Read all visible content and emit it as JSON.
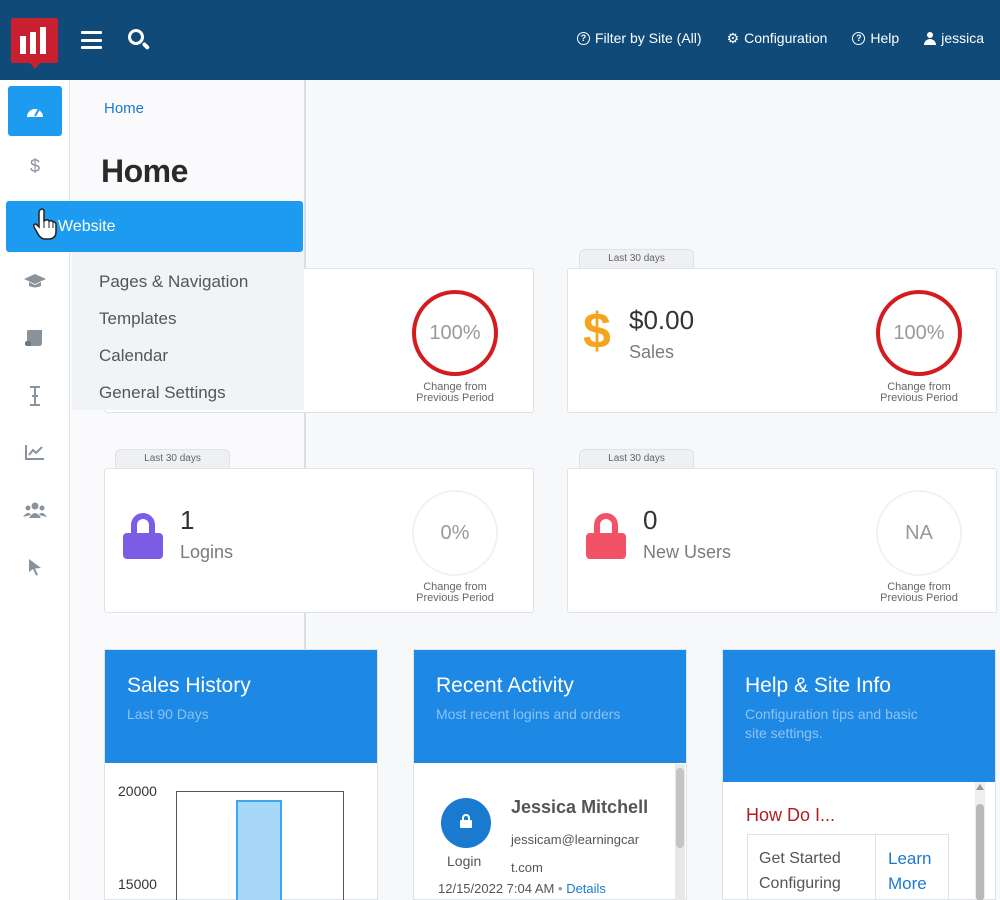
{
  "topbar": {
    "nav": [
      {
        "icon": "question-circle-icon",
        "label": "Filter by Site (All)"
      },
      {
        "icon": "gear-icon",
        "label": "Configuration"
      },
      {
        "icon": "question-circle-icon",
        "label": "Help"
      },
      {
        "icon": "user-icon",
        "label": "jessica"
      }
    ]
  },
  "rail": {
    "items": [
      "dashboard-icon",
      "dollar-icon",
      "globe-icon",
      "graduation-cap-icon",
      "scroll-icon",
      "text-cursor-icon",
      "chart-line-icon",
      "users-icon",
      "pointer-icon"
    ]
  },
  "menu": {
    "website_label": "Website",
    "submenu": [
      "Pages & Navigation",
      "Templates",
      "Calendar",
      "General Settings"
    ]
  },
  "breadcrumb": "Home",
  "page_title": "Home",
  "stats": [
    {
      "tab": "",
      "value": "",
      "label": "",
      "change": "100%",
      "change_caption_1": "Change from",
      "change_caption_2": "Previous Period"
    },
    {
      "tab": "Last 30 days",
      "value": "$0.00",
      "label": "Sales",
      "change": "100%",
      "change_caption_1": "Change from",
      "change_caption_2": "Previous Period"
    },
    {
      "tab": "Last 30 days",
      "value": "1",
      "label": "Logins",
      "change": "0%",
      "change_caption_1": "Change from",
      "change_caption_2": "Previous Period"
    },
    {
      "tab": "Last 30 days",
      "value": "0",
      "label": "New Users",
      "change": "NA",
      "change_caption_1": "Change from",
      "change_caption_2": "Previous Period"
    }
  ],
  "panels": {
    "sales": {
      "title": "Sales History",
      "subtitle": "Last 90 Days"
    },
    "activity": {
      "title": "Recent Activity",
      "subtitle": "Most recent logins and orders"
    },
    "help": {
      "title": "Help & Site Info",
      "subtitle_1": "Configuration tips and basic",
      "subtitle_2": "site settings."
    }
  },
  "chart_data": {
    "type": "bar",
    "yticks": [
      "20000",
      "15000"
    ],
    "values": [
      19500
    ]
  },
  "activity": {
    "name": "Jessica Mitchell",
    "email_1": "jessicam@learningcar",
    "email_2": "t.com",
    "type": "Login",
    "timestamp": "12/15/2022 7:04 AM",
    "separator": "•",
    "link": "Details"
  },
  "help": {
    "how_title": "How Do I...",
    "row_left_1": "Get Started",
    "row_left_2": "Configuring",
    "row_right_1": "Learn",
    "row_right_2": "More"
  },
  "colors": {
    "topbar": "#0f4a79",
    "accent": "#1d9bf0",
    "panel_head": "#1e88e5",
    "ring_red": "#d31b20",
    "lock_purple": "#7b5ce6",
    "lock_red": "#f25166",
    "dollar_gold": "#f4a51c"
  }
}
